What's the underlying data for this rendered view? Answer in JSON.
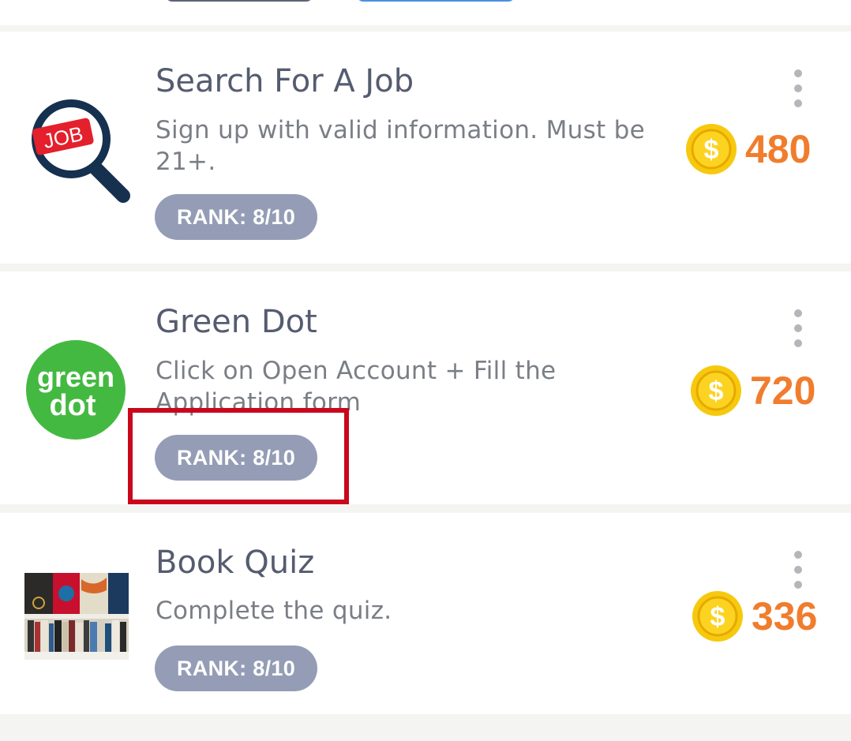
{
  "colors": {
    "title": "#555c70",
    "description": "#7a7e85",
    "rank_badge": "#949db5",
    "points": "#f07d2d",
    "coin": "#f4c20d",
    "highlight": "#c9081c"
  },
  "offers": [
    {
      "title": "Search For A Job",
      "description": "Sign up with valid information. Must be 21+.",
      "rank": "RANK: 8/10",
      "points": "480",
      "icon": "job-search-magnifier-icon",
      "icon_text": "JOB"
    },
    {
      "title": "Green Dot",
      "description": "Click on Open Account + Fill the Application form",
      "rank": "RANK: 8/10",
      "points": "720",
      "icon": "green-dot-logo",
      "icon_text_1": "green",
      "icon_text_2": "dot"
    },
    {
      "title": "Book Quiz",
      "description": "Complete the quiz.",
      "rank": "RANK: 8/10",
      "points": "336",
      "icon": "books-thumbnail"
    }
  ],
  "coin_symbol": "$"
}
